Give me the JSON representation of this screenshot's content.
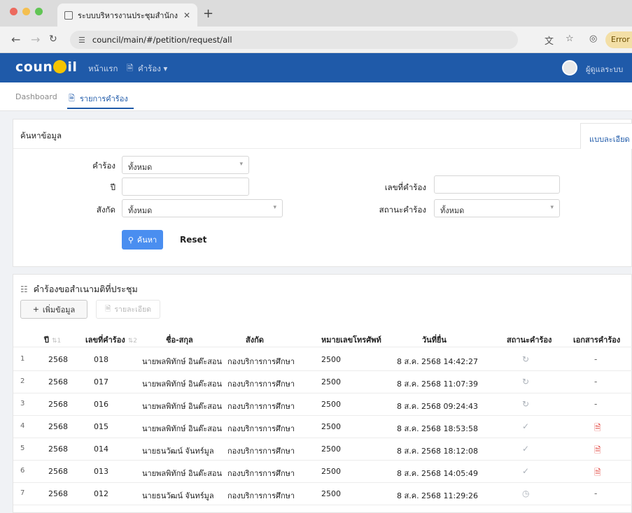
{
  "browser": {
    "tab_title": "ระบบบริหารงานประชุมสำนักงาน",
    "url": "council/main/#/petition/request/all",
    "error_label": "Error"
  },
  "header": {
    "brand_left": "coun",
    "brand_right": "il",
    "nav": [
      {
        "label": "หน้าแรก"
      },
      {
        "label": "คำร้อง ▾"
      }
    ],
    "user_label": "ผู้ดูแลระบบ"
  },
  "breadcrumbs": [
    {
      "label": "Dashboard"
    },
    {
      "label": "รายการคำร้อง"
    }
  ],
  "search": {
    "title": "ค้นหาข้อมูล",
    "advanced_tab": "แบบละเอียด",
    "fields": {
      "request_label": "คำร้อง",
      "request_value": "ทั้งหมด",
      "year_label": "ปี",
      "year_value": "",
      "request_no_label": "เลขที่คำร้อง",
      "request_no_value": "",
      "affiliation_label": "สังกัด",
      "affiliation_value": "ทั้งหมด",
      "status_label": "สถานะคำร้อง",
      "status_value": "ทั้งหมด"
    },
    "search_button": "ค้นหา",
    "reset_button": "Reset"
  },
  "table": {
    "title": "คำร้องขอสำเนามติที่ประชุม",
    "add_button": "เพิ่มข้อมูล",
    "detail_button": "รายละเอียด",
    "columns": {
      "year": "ปี",
      "year_sort": "1",
      "request_no": "เลขที่คำร้อง",
      "request_no_sort": "2",
      "name": "ชื่อ-สกุล",
      "affiliation": "สังกัด",
      "phone": "หมายเลขโทรศัพท์",
      "date": "วันที่ยื่น",
      "status": "สถานะคำร้อง",
      "document": "เอกสารคำร้อง"
    },
    "rows": [
      {
        "n": "1",
        "year": "2568",
        "no": "018",
        "name": "นายพลพิทักษ์ อินต๊ะสอน",
        "aff": "กองบริการการศึกษา",
        "phone": "2500",
        "date": "8 ส.ค. 2568 14:42:27",
        "status": "pending-icon",
        "doc": "-"
      },
      {
        "n": "2",
        "year": "2568",
        "no": "017",
        "name": "นายพลพิทักษ์ อินต๊ะสอน",
        "aff": "กองบริการการศึกษา",
        "phone": "2500",
        "date": "8 ส.ค. 2568 11:07:39",
        "status": "pending-icon",
        "doc": "-"
      },
      {
        "n": "3",
        "year": "2568",
        "no": "016",
        "name": "นายพลพิทักษ์ อินต๊ะสอน",
        "aff": "กองบริการการศึกษา",
        "phone": "2500",
        "date": "8 ส.ค. 2568 09:24:43",
        "status": "pending-icon",
        "doc": "-"
      },
      {
        "n": "4",
        "year": "2568",
        "no": "015",
        "name": "นายพลพิทักษ์ อินต๊ะสอน",
        "aff": "กองบริการการศึกษา",
        "phone": "2500",
        "date": "8 ส.ค. 2568 18:53:58",
        "status": "check-icon",
        "doc": "pdf-icon"
      },
      {
        "n": "5",
        "year": "2568",
        "no": "014",
        "name": "นายธนวัฒน์ จันทร์มูล",
        "aff": "กองบริการการศึกษา",
        "phone": "2500",
        "date": "8 ส.ค. 2568 18:12:08",
        "status": "check-icon",
        "doc": "pdf-icon"
      },
      {
        "n": "6",
        "year": "2568",
        "no": "013",
        "name": "นายพลพิทักษ์ อินต๊ะสอน",
        "aff": "กองบริการการศึกษา",
        "phone": "2500",
        "date": "8 ส.ค. 2568 14:05:49",
        "status": "check-icon",
        "doc": "pdf-icon"
      },
      {
        "n": "7",
        "year": "2568",
        "no": "012",
        "name": "นายธนวัฒน์ จันทร์มูล",
        "aff": "กองบริการการศึกษา",
        "phone": "2500",
        "date": "8 ส.ค. 2568 11:29:26",
        "status": "clock-icon",
        "doc": "-"
      }
    ]
  },
  "colors": {
    "brand": "#1f5aa9",
    "accent": "#4a8ef0",
    "pdf": "#e2403a",
    "logo_dot": "#f5c400"
  }
}
